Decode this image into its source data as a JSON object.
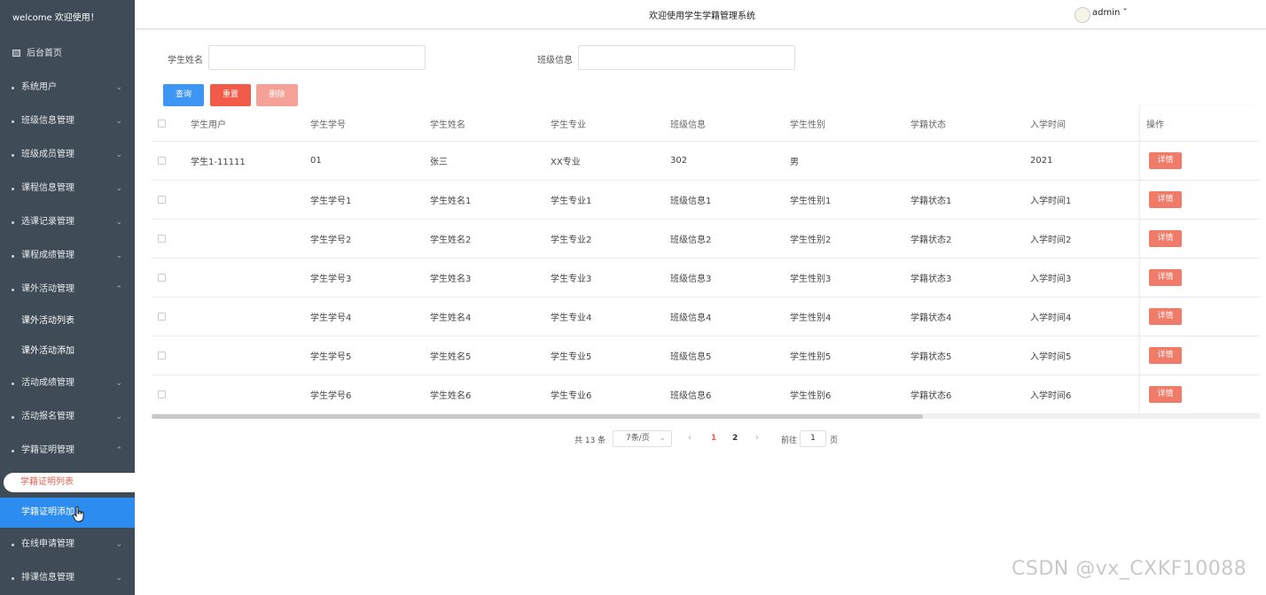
{
  "sidebar": {
    "welcome": "welcome 欢迎使用！",
    "home": "后台首页",
    "menus": [
      {
        "label": "系统用户",
        "chev": "⌄"
      },
      {
        "label": "班级信息管理",
        "chev": "⌄"
      },
      {
        "label": "班级成员管理",
        "chev": "⌄"
      },
      {
        "label": "课程信息管理",
        "chev": "⌄"
      },
      {
        "label": "选课记录管理",
        "chev": "⌄"
      },
      {
        "label": "课程成绩管理",
        "chev": "⌄"
      },
      {
        "label": "课外活动管理",
        "chev": "⌃"
      },
      {
        "label": "活动成绩管理",
        "chev": "⌄"
      },
      {
        "label": "活动报名管理",
        "chev": "⌄"
      },
      {
        "label": "学籍证明管理",
        "chev": "⌃"
      },
      {
        "label": "在线申请管理",
        "chev": "⌄"
      },
      {
        "label": "排课信息管理",
        "chev": "⌄"
      }
    ],
    "sub": {
      "activity_list": "课外活动列表",
      "activity_add": "课外活动添加",
      "cert_list": "学籍证明列表",
      "cert_add": "学籍证明添加"
    }
  },
  "header": {
    "title": "欢迎使用学生学籍管理系统",
    "user": "admin ˅"
  },
  "search": {
    "name_label": "学生姓名",
    "name_value": "",
    "class_label": "班级信息",
    "class_value": "",
    "query": "查询",
    "reset": "重置",
    "delete": "删除"
  },
  "table": {
    "headers": [
      "学生用户",
      "学生学号",
      "学生姓名",
      "学生专业",
      "班级信息",
      "学生性别",
      "学籍状态",
      "入学时间",
      "操作"
    ],
    "detail_label": "详情",
    "rows": [
      [
        "学生1-11111",
        "01",
        "张三",
        "XX专业",
        "302",
        "男",
        "",
        "2021"
      ],
      [
        "",
        "学生学号1",
        "学生姓名1",
        "学生专业1",
        "班级信息1",
        "学生性别1",
        "学籍状态1",
        "入学时间1"
      ],
      [
        "",
        "学生学号2",
        "学生姓名2",
        "学生专业2",
        "班级信息2",
        "学生性别2",
        "学籍状态2",
        "入学时间2"
      ],
      [
        "",
        "学生学号3",
        "学生姓名3",
        "学生专业3",
        "班级信息3",
        "学生性别3",
        "学籍状态3",
        "入学时间3"
      ],
      [
        "",
        "学生学号4",
        "学生姓名4",
        "学生专业4",
        "班级信息4",
        "学生性别4",
        "学籍状态4",
        "入学时间4"
      ],
      [
        "",
        "学生学号5",
        "学生姓名5",
        "学生专业5",
        "班级信息5",
        "学生性别5",
        "学籍状态5",
        "入学时间5"
      ],
      [
        "",
        "学生学号6",
        "学生姓名6",
        "学生专业6",
        "班级信息6",
        "学生性别6",
        "学籍状态6",
        "入学时间6"
      ]
    ]
  },
  "pagination": {
    "total": "共 13 条",
    "page_size": "7条/页",
    "prev": "‹",
    "pages": [
      "1",
      "2"
    ],
    "next": "›",
    "goto_prefix": "前往",
    "goto_value": "1",
    "goto_suffix": "页"
  },
  "watermark": "CSDN @vx_CXKF10088",
  "colors": {
    "sidebar_bg": "#3f4b57",
    "primary": "#3d95f4",
    "danger": "#f15b48",
    "detail": "#f07b68",
    "active_sub": "#2d8cf0"
  }
}
